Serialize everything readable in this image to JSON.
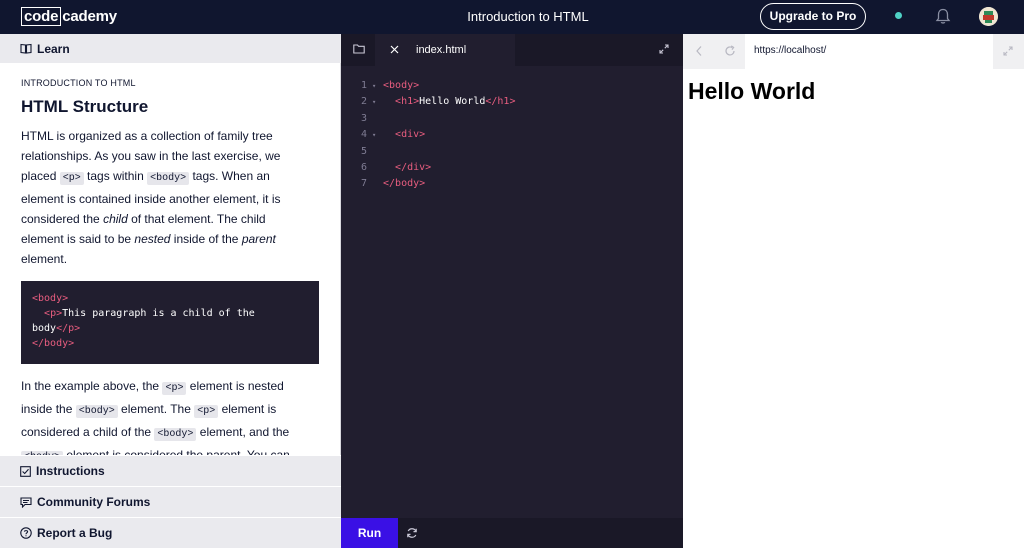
{
  "topbar": {
    "logo_code": "code",
    "logo_cademy": "cademy",
    "course_title": "Introduction to HTML",
    "upgrade_label": "Upgrade to Pro"
  },
  "learn_panel": {
    "tab_label": "Learn",
    "eyebrow": "INTRODUCTION TO HTML",
    "heading": "HTML Structure",
    "p1": {
      "t1": "HTML is organized as a collection of family tree relationships. As you saw in the last exercise, we placed ",
      "c1": "<p>",
      "t2": " tags within ",
      "c2": "<body>",
      "t3": " tags. When an element is contained inside another element, it is considered the ",
      "em1": "child",
      "t4": " of that element. The child element is said to be ",
      "em2": "nested",
      "t5": " inside of the ",
      "em3": "parent",
      "t6": " element."
    },
    "code_example": {
      "l1_tag": "<body>",
      "l2_tag": "<p>",
      "l2_text": "This paragraph is a child of the",
      "l3_text": "body",
      "l3_tag": "</p>",
      "l4_tag": "</body>"
    },
    "p2": {
      "t1": "In the example above, the ",
      "c1": "<p>",
      "t2": " element is nested inside the ",
      "c2": "<body>",
      "t3": " element. The ",
      "c3": "<p>",
      "t4": " element is considered a child of the ",
      "c4": "<body>",
      "t5": " element, and the ",
      "c5": "<body>",
      "t6": " element is considered the parent. You can"
    },
    "bottom_tabs": {
      "instructions": "Instructions",
      "forums": "Community Forums",
      "bug": "Report a Bug"
    }
  },
  "editor": {
    "file_name": "index.html",
    "lines": [
      {
        "num": "1",
        "fold": "▾",
        "tag_open": "<",
        "tag": "body",
        "tag_close": ">",
        "text": ""
      },
      {
        "num": "2",
        "fold": "▾",
        "indent": "  ",
        "tag_open": "<h1>",
        "text": "Hello World",
        "tag_end": "</h1>"
      },
      {
        "num": "3",
        "fold": "",
        "text": ""
      },
      {
        "num": "4",
        "fold": "▾",
        "indent": "  ",
        "tag_open": "<div>"
      },
      {
        "num": "5",
        "fold": "",
        "text": ""
      },
      {
        "num": "6",
        "fold": "",
        "indent": "  ",
        "tag_open": "</div>"
      },
      {
        "num": "7",
        "fold": "",
        "tag_open": "</",
        "tag": "body",
        "tag_close": ">"
      }
    ],
    "run_label": "Run"
  },
  "browser": {
    "url": "https://localhost/",
    "content_heading": "Hello World"
  },
  "colors": {
    "topbar_bg": "#10162f",
    "editor_bg": "#211e2f",
    "tag_pink": "#e85d7f",
    "run_blue": "#3a10e5",
    "status_teal": "#4fd1c5"
  }
}
